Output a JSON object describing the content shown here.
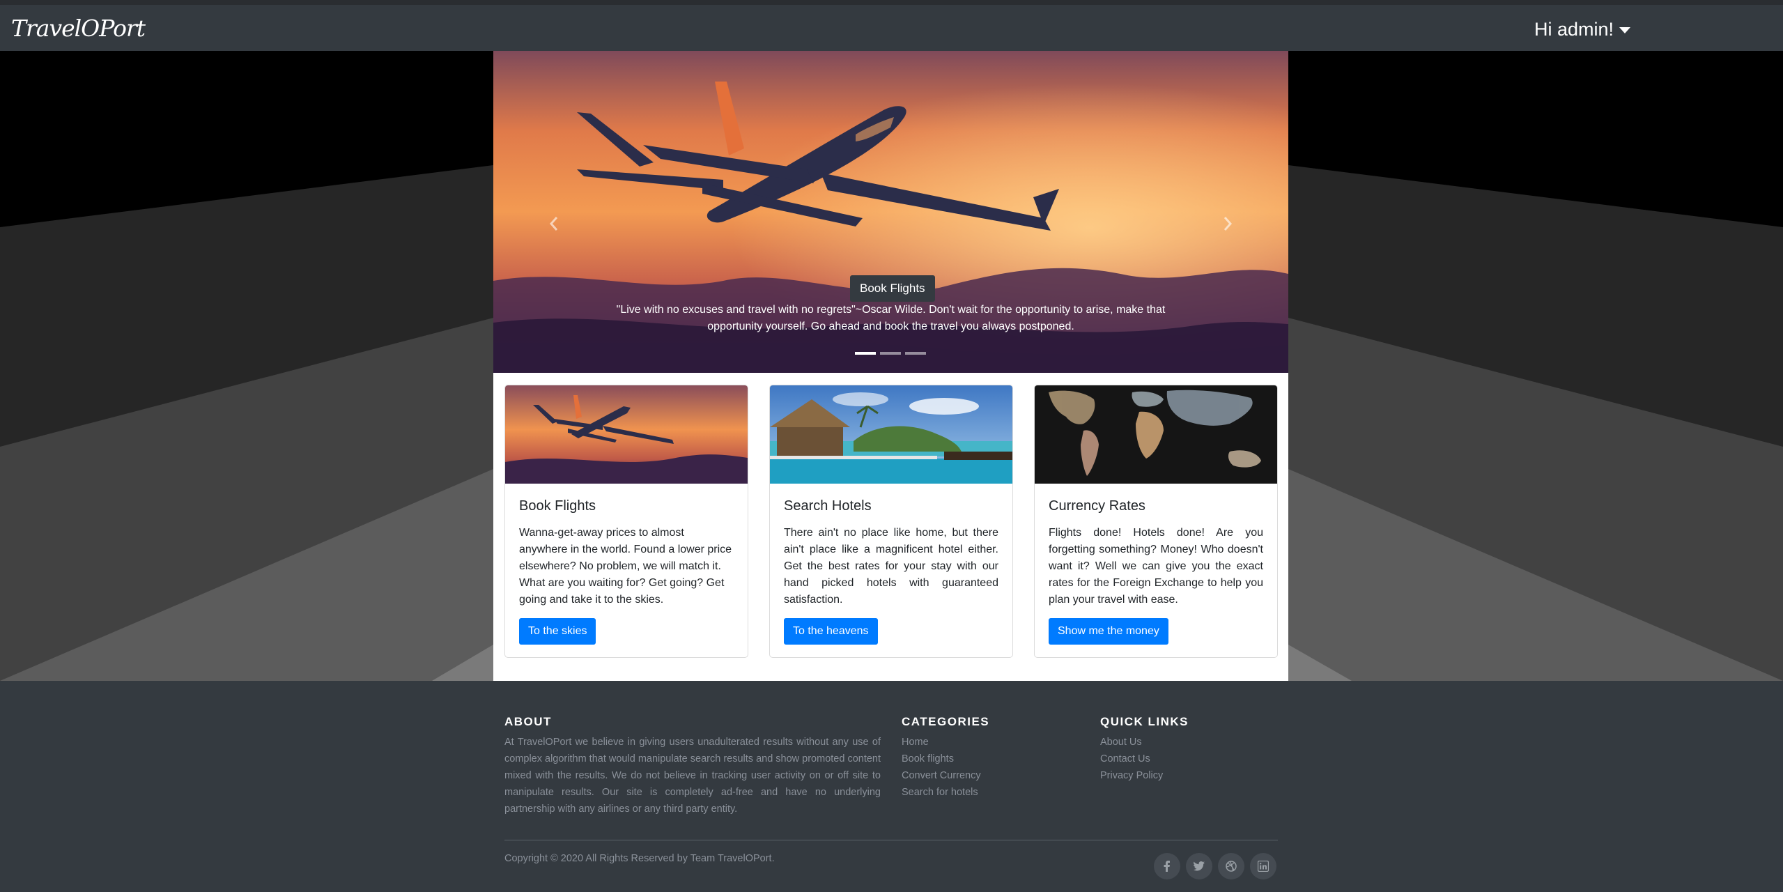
{
  "navbar": {
    "brand": "TravelOPort",
    "user_greeting": "Hi admin!"
  },
  "carousel": {
    "caption_title": "Book Flights",
    "caption_text": "\"Live with no excuses and travel with no regrets\"~Oscar Wilde. Don't wait for the opportunity to arise, make that opportunity yourself. Go ahead and book the travel you always postponed.",
    "active_slide": 1,
    "slide_count": 3
  },
  "cards": [
    {
      "title": "Book Flights",
      "text": "Wanna-get-away prices to almost anywhere in the world. Found a lower price elsewhere? No problem, we will match it. What are you waiting for? Get going? Get going and take it to the skies.",
      "button": "To the skies"
    },
    {
      "title": "Search Hotels",
      "text": "There ain't no place like home, but there ain't place like a magnificent hotel either. Get the best rates for your stay with our hand picked hotels with guaranteed satisfaction.",
      "button": "To the heavens"
    },
    {
      "title": "Currency Rates",
      "text": "Flights done! Hotels done! Are you forgetting something? Money! Who doesn't want it? Well we can give you the exact rates for the Foreign Exchange to help you plan your travel with ease.",
      "button": "Show me the money"
    }
  ],
  "footer": {
    "about_heading": "ABOUT",
    "about_text": "At TravelOPort we believe in giving users unadulterated results without any use of complex algorithm that would manipulate search results and show promoted content mixed with the results. We do not believe in tracking user activity on or off site to manipulate results. Our site is completely ad-free and have no underlying partnership with any airlines or any third party entity.",
    "categories_heading": "CATEGORIES",
    "categories": [
      "Home",
      "Book flights",
      "Convert Currency",
      "Search for hotels"
    ],
    "quicklinks_heading": "QUICK LINKS",
    "quicklinks": [
      "About Us",
      "Contact Us",
      "Privacy Policy"
    ],
    "copyright": "Copyright © 2020 All Rights Reserved by Team TravelOPort.",
    "social_icons": [
      "facebook-icon",
      "twitter-icon",
      "dribbble-icon",
      "linkedin-icon"
    ]
  },
  "colors": {
    "navbar": "#343a40",
    "primary_button": "#007bff",
    "footer_text": "#8a9099"
  }
}
